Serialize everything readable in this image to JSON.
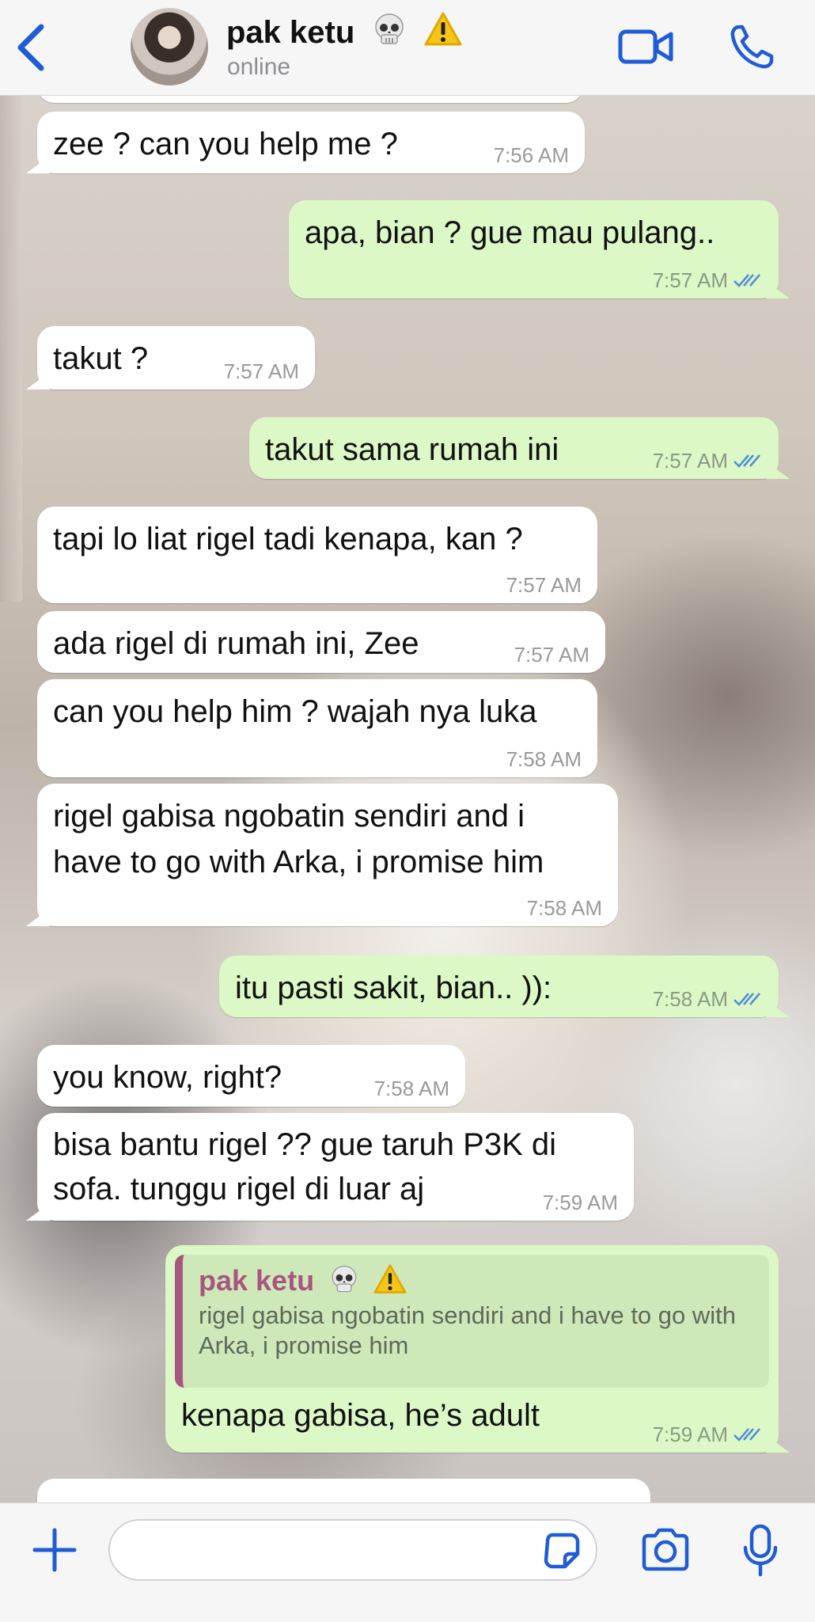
{
  "header": {
    "contact_name": "pak ketu",
    "status": "online"
  },
  "theme": {
    "accent": "#1f5cd6",
    "outgoing_bubble": "#dcf8c6",
    "incoming_bubble": "#ffffff",
    "tick_color": "#4f8ed9",
    "reply_accent": "#a8567f"
  },
  "icons": [
    "chevron-left-icon",
    "video-camera-icon",
    "phone-icon",
    "skull-emoji",
    "warning-emoji",
    "plus-icon",
    "sticker-icon",
    "camera-icon",
    "microphone-icon",
    "double-check-icon"
  ],
  "messages": [
    {
      "direction": "in",
      "text": "zee ? can you help me ?",
      "time": "7:56 AM"
    },
    {
      "direction": "out",
      "text": "apa, bian ? gue mau pulang..",
      "time": "7:57 AM",
      "read": true
    },
    {
      "direction": "in",
      "text": "takut ?",
      "time": "7:57 AM"
    },
    {
      "direction": "out",
      "text": "takut sama rumah ini",
      "time": "7:57 AM",
      "read": true
    },
    {
      "direction": "in",
      "text": "tapi lo liat rigel tadi kenapa, kan ?",
      "time": "7:57 AM"
    },
    {
      "direction": "in",
      "text": "ada rigel di rumah ini, Zee",
      "time": "7:57 AM"
    },
    {
      "direction": "in",
      "text": "can you help him ? wajah nya luka",
      "time": "7:58 AM"
    },
    {
      "direction": "in",
      "text": "rigel gabisa ngobatin sendiri and i have to go with Arka, i promise him",
      "time": "7:58 AM"
    },
    {
      "direction": "out",
      "text": "itu pasti sakit, bian.. )):",
      "time": "7:58 AM",
      "read": true
    },
    {
      "direction": "in",
      "text": "you know, right?",
      "time": "7:58 AM"
    },
    {
      "direction": "in",
      "text": "bisa bantu rigel ?? gue taruh P3K di sofa. tunggu rigel di luar aj",
      "time": "7:59 AM"
    },
    {
      "direction": "out",
      "reply_to": {
        "name": "pak ketu",
        "text": "rigel gabisa ngobatin sendiri and i have to go with Arka, i promise him"
      },
      "text": "kenapa gabisa, he’s adult",
      "time": "7:59 AM",
      "read": true
    }
  ],
  "input": {
    "placeholder": ""
  }
}
